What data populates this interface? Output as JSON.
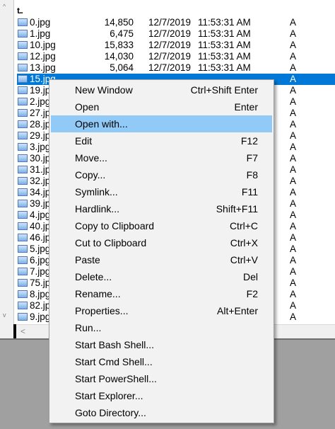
{
  "parent_dir_icon": "up-directory-icon",
  "files": [
    {
      "name": "0.jpg",
      "size": "14,850",
      "date": "12/7/2019",
      "time": "11:53:31 AM",
      "attr": "A"
    },
    {
      "name": "1.jpg",
      "size": "6,475",
      "date": "12/7/2019",
      "time": "11:53:31 AM",
      "attr": "A"
    },
    {
      "name": "10.jpg",
      "size": "15,833",
      "date": "12/7/2019",
      "time": "11:53:31 AM",
      "attr": "A"
    },
    {
      "name": "12.jpg",
      "size": "14,030",
      "date": "12/7/2019",
      "time": "11:53:31 AM",
      "attr": "A"
    },
    {
      "name": "13.jpg",
      "size": "5,064",
      "date": "12/7/2019",
      "time": "11:53:31 AM",
      "attr": "A"
    },
    {
      "name": "15.jpg",
      "size": "",
      "date": "",
      "time": "",
      "attr": "A",
      "selected": true
    },
    {
      "name": "19.jpg",
      "attr": "A"
    },
    {
      "name": "2.jpg",
      "attr": "A"
    },
    {
      "name": "27.jpg",
      "attr": "A"
    },
    {
      "name": "28.jpg",
      "attr": "A"
    },
    {
      "name": "29.jpg",
      "attr": "A"
    },
    {
      "name": "3.jpg",
      "attr": "A"
    },
    {
      "name": "30.jpg",
      "attr": "A"
    },
    {
      "name": "31.jpg",
      "attr": "A"
    },
    {
      "name": "32.jpg",
      "attr": "A"
    },
    {
      "name": "34.jpg",
      "attr": "A"
    },
    {
      "name": "39.jpg",
      "attr": "A"
    },
    {
      "name": "4.jpg",
      "attr": "A"
    },
    {
      "name": "40.jpg",
      "attr": "A"
    },
    {
      "name": "46.jpg",
      "attr": "A"
    },
    {
      "name": "5.jpg",
      "attr": "A"
    },
    {
      "name": "6.jpg",
      "attr": "A"
    },
    {
      "name": "7.jpg",
      "attr": "A"
    },
    {
      "name": "75.jpg",
      "attr": "A"
    },
    {
      "name": "8.jpg",
      "attr": "A"
    },
    {
      "name": "82.jpg",
      "attr": "A"
    },
    {
      "name": "9.jpg",
      "attr": "A"
    }
  ],
  "context_menu": [
    {
      "label": "New Window",
      "shortcut": "Ctrl+Shift Enter"
    },
    {
      "label": "Open",
      "shortcut": "Enter"
    },
    {
      "label": "Open with...",
      "shortcut": "",
      "highlighted": true
    },
    {
      "label": "Edit",
      "shortcut": "F12"
    },
    {
      "label": "Move...",
      "shortcut": "F7"
    },
    {
      "label": "Copy...",
      "shortcut": "F8"
    },
    {
      "label": "Symlink...",
      "shortcut": "F11"
    },
    {
      "label": "Hardlink...",
      "shortcut": "Shift+F11"
    },
    {
      "label": "Copy to Clipboard",
      "shortcut": "Ctrl+C"
    },
    {
      "label": "Cut to Clipboard",
      "shortcut": "Ctrl+X"
    },
    {
      "label": "Paste",
      "shortcut": "Ctrl+V"
    },
    {
      "label": "Delete...",
      "shortcut": "Del"
    },
    {
      "label": "Rename...",
      "shortcut": "F2"
    },
    {
      "label": "Properties...",
      "shortcut": "Alt+Enter"
    },
    {
      "label": "Run...",
      "shortcut": ""
    },
    {
      "label": "Start Bash Shell...",
      "shortcut": ""
    },
    {
      "label": "Start Cmd Shell...",
      "shortcut": ""
    },
    {
      "label": "Start PowerShell...",
      "shortcut": ""
    },
    {
      "label": "Start Explorer...",
      "shortcut": ""
    },
    {
      "label": "Goto Directory...",
      "shortcut": ""
    }
  ],
  "colors": {
    "selection": "#0078d7",
    "menu_hover": "#91c9f7",
    "menu_bg": "#f2f2f2",
    "desktop": "#a0a0a0"
  }
}
